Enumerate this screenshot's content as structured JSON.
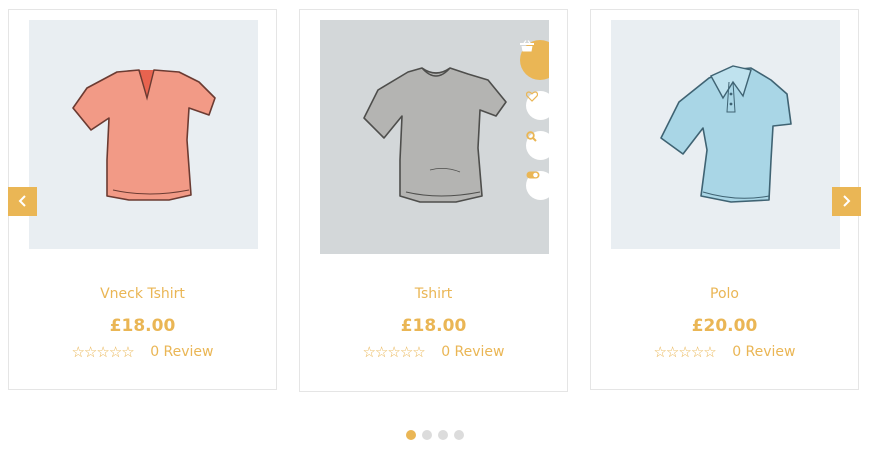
{
  "colors": {
    "accent": "#eab655",
    "card_border": "#e5e5e5",
    "thumb_bg": "#e9eef2",
    "thumb_hover_bg": "#d3d7d9",
    "dot_inactive": "#dcdcdc"
  },
  "carousel": {
    "prev_icon": "chevron-left-icon",
    "next_icon": "chevron-right-icon",
    "page_count": 4,
    "active_page": 1
  },
  "products": [
    {
      "name": "Vneck Tshirt",
      "price": "£18.00",
      "stars": "☆☆☆☆☆",
      "rating": 0,
      "review_text": "0 Review",
      "image": "salmon v-neck t-shirt"
    },
    {
      "name": "Tshirt",
      "price": "£18.00",
      "stars": "☆☆☆☆☆",
      "rating": 0,
      "review_text": "0 Review",
      "image": "grey t-shirt",
      "actions": [
        "basket-icon",
        "heart-icon",
        "search-icon",
        "toggle-icon"
      ]
    },
    {
      "name": "Polo",
      "price": "£20.00",
      "stars": "☆☆☆☆☆",
      "rating": 0,
      "review_text": "0 Review",
      "image": "light blue polo shirt"
    }
  ]
}
